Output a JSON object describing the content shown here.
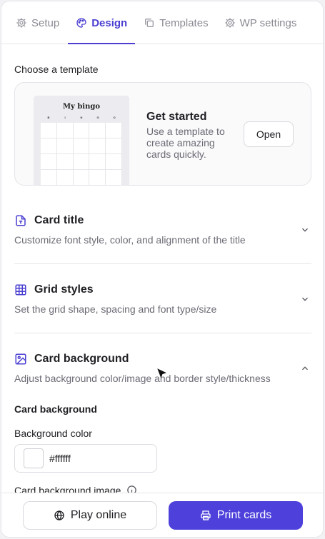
{
  "tabs": [
    {
      "label": "Setup",
      "icon": "gear-icon",
      "active": false
    },
    {
      "label": "Design",
      "icon": "palette-icon",
      "active": true
    },
    {
      "label": "Templates",
      "icon": "copy-icon",
      "active": false
    },
    {
      "label": "WP settings",
      "icon": "gear-icon",
      "active": false
    }
  ],
  "template": {
    "section_label": "Choose a template",
    "preview_title": "My bingo",
    "preview_letters": [
      "B",
      "I",
      "N",
      "G",
      "O"
    ],
    "heading": "Get started",
    "description": "Use a template to create amazing cards quickly.",
    "open_label": "Open"
  },
  "accordions": [
    {
      "title": "Card title",
      "description": "Customize font style, color, and alignment of the title",
      "icon": "text-file-icon",
      "expanded": false
    },
    {
      "title": "Grid styles",
      "description": "Set the grid shape, spacing and font type/size",
      "icon": "grid-icon",
      "expanded": false
    },
    {
      "title": "Card background",
      "description": "Adjust background color/image and border style/thickness",
      "icon": "image-icon",
      "expanded": true
    }
  ],
  "background": {
    "section_title": "Card background",
    "color_label": "Background color",
    "color_value": "#ffffff",
    "image_label": "Card background image"
  },
  "footer": {
    "play_label": "Play online",
    "print_label": "Print cards"
  },
  "colors": {
    "accent": "#4a3fd1",
    "primary_button": "#4d40db"
  }
}
